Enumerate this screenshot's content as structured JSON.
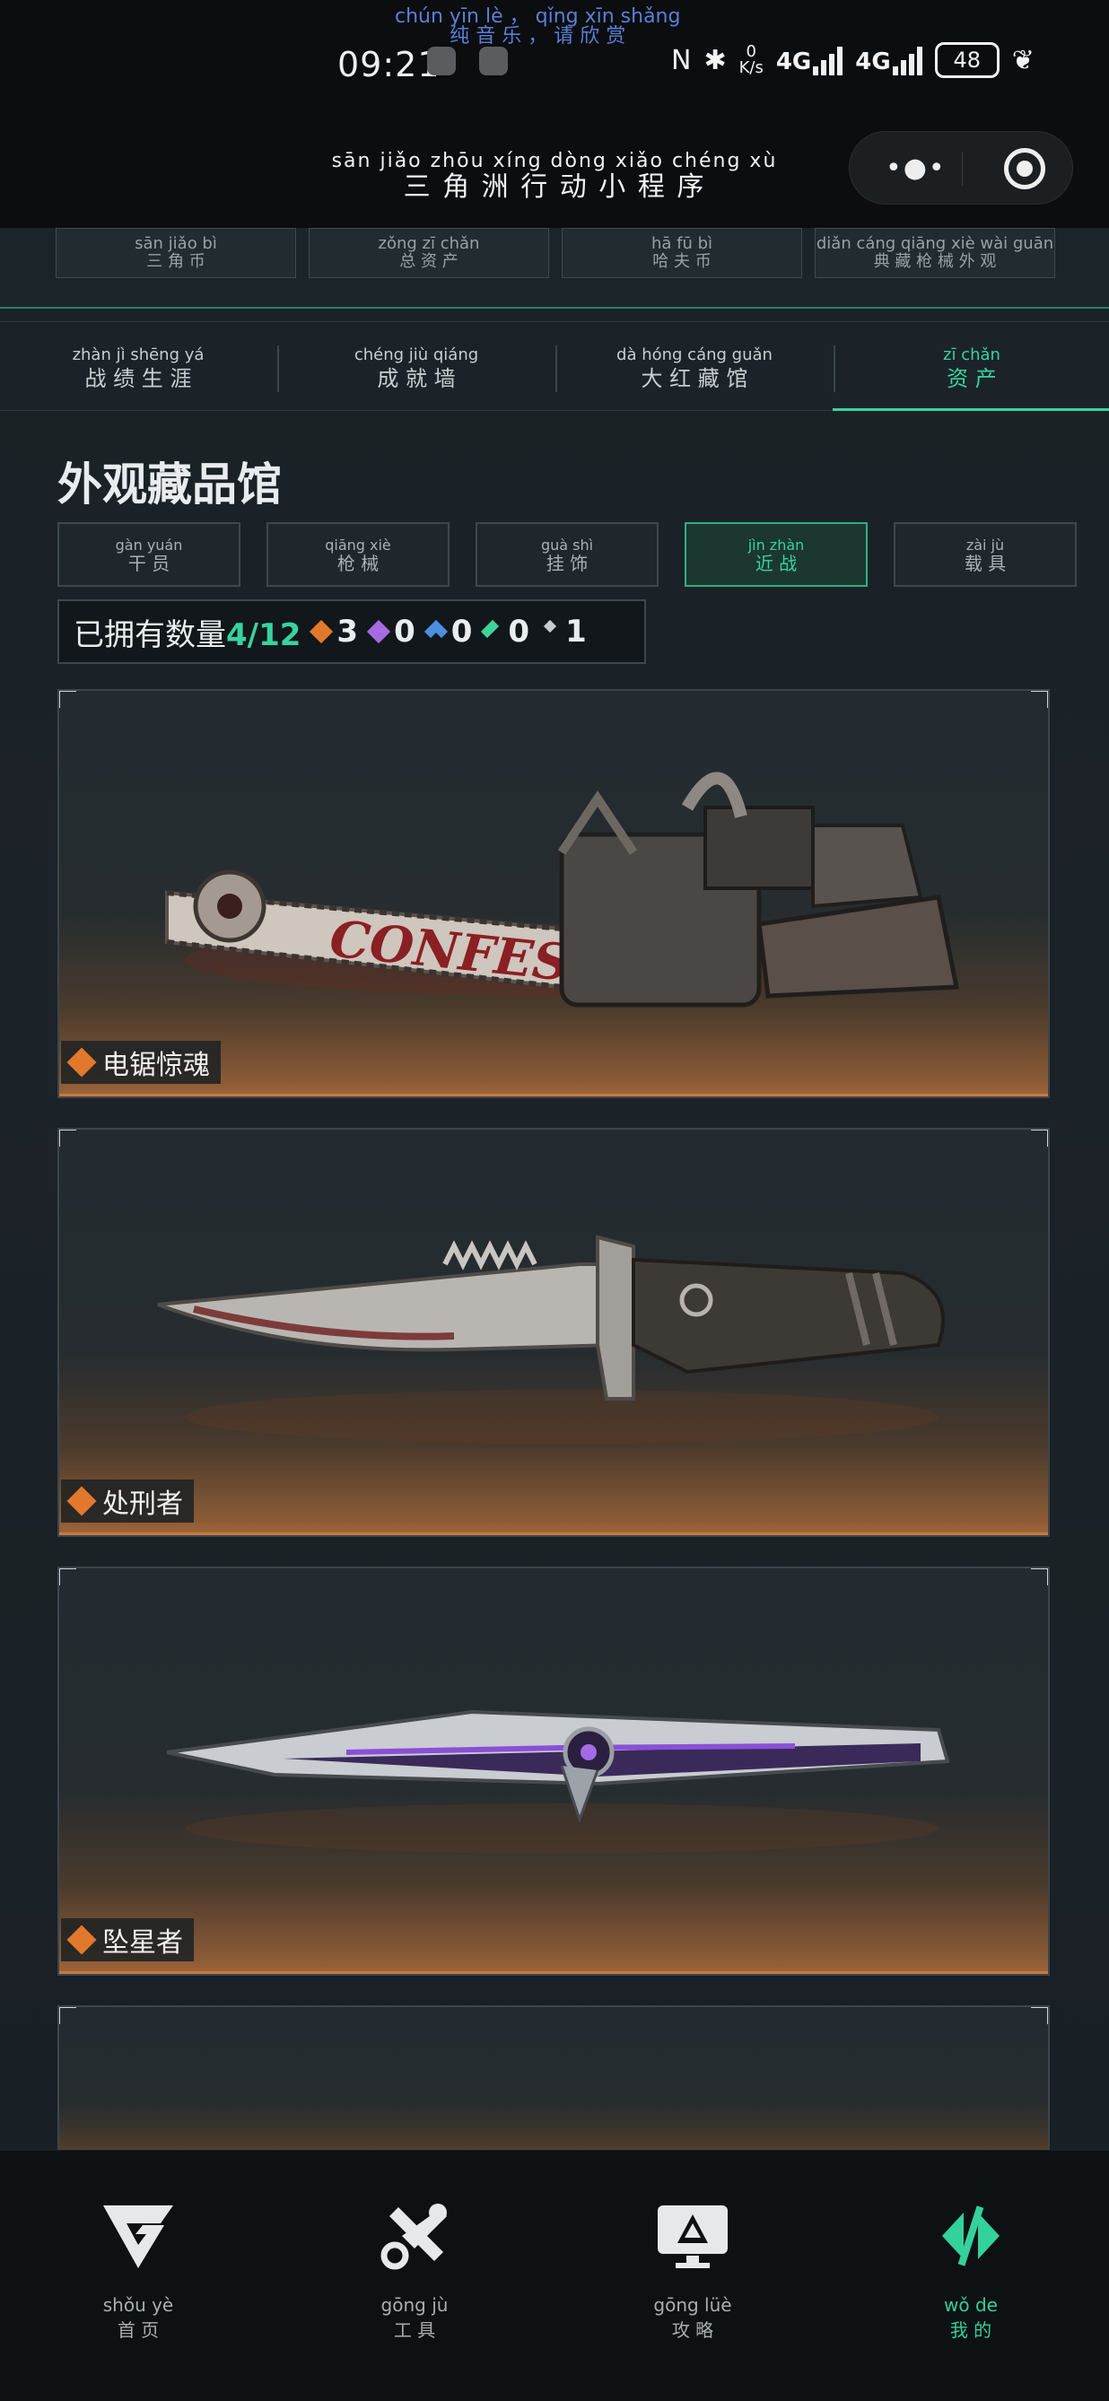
{
  "status_bar": {
    "banner_line1": "chún yīn lè ， qǐng xīn shǎng",
    "banner_line2": "纯 音 乐 ， 请 欣 赏",
    "time": "09:21",
    "net_speed_value": "0",
    "net_speed_unit": "K/s",
    "sim1": "4G",
    "sim2": "4G",
    "battery": "48"
  },
  "nav": {
    "title_pinyin": "sān jiǎo zhōu xíng dòng xiǎo chéng xù",
    "title": "三 角 洲 行 动 小 程 序"
  },
  "top_strip": [
    {
      "pinyin": "sān jiǎo bì",
      "label": "三 角 币"
    },
    {
      "pinyin": "zǒng zī chǎn",
      "label": "总 资 产"
    },
    {
      "pinyin": "hā fū bì",
      "label": "哈 夫 币"
    },
    {
      "pinyin": "diǎn cáng qiāng xiè wài guān",
      "label": "典 藏 枪 械 外 观"
    }
  ],
  "tabs": [
    {
      "pinyin": "zhàn jì shēng yá",
      "label": "战 绩 生 涯"
    },
    {
      "pinyin": "chéng jiù qiáng",
      "label": "成 就 墙"
    },
    {
      "pinyin": "dà hóng cáng guǎn",
      "label": "大 红 藏 馆"
    },
    {
      "pinyin": "zī chǎn",
      "label": "资 产"
    }
  ],
  "section_title": "外观藏品馆",
  "categories": [
    {
      "pinyin": "gàn yuán",
      "label": "干 员"
    },
    {
      "pinyin": "qiāng xiè",
      "label": "枪 械"
    },
    {
      "pinyin": "guà shì",
      "label": "挂 饰"
    },
    {
      "pinyin": "jìn zhàn",
      "label": "近 战"
    },
    {
      "pinyin": "zài jù",
      "label": "载 具"
    }
  ],
  "counts": {
    "label": "已拥有数量",
    "owned": "4/12",
    "rarity": [
      {
        "color": "#e2782c",
        "count": "3"
      },
      {
        "color": "#a66be0",
        "count": "0"
      },
      {
        "color": "#4d8ee0",
        "count": "0"
      },
      {
        "color": "#3fd39a",
        "count": "0"
      },
      {
        "color": "#c8ccce",
        "count": "1"
      }
    ]
  },
  "items": [
    {
      "name": "电锯惊魂",
      "engraving": "CONFESS",
      "rarity_color": "#e2782c"
    },
    {
      "name": "处刑者",
      "rarity_color": "#e2782c"
    },
    {
      "name": "坠星者",
      "rarity_color": "#e2782c"
    }
  ],
  "bottom_tabs": [
    {
      "pinyin": "shǒu yè",
      "label": "首 页",
      "icon": "home-g-logo-icon"
    },
    {
      "pinyin": "gōng jù",
      "label": "工 具",
      "icon": "tools-icon"
    },
    {
      "pinyin": "gōng lüè",
      "label": "攻 略",
      "icon": "guide-monitor-icon"
    },
    {
      "pinyin": "wǒ de",
      "label": "我 的",
      "icon": "profile-logo-icon",
      "active": true
    }
  ]
}
